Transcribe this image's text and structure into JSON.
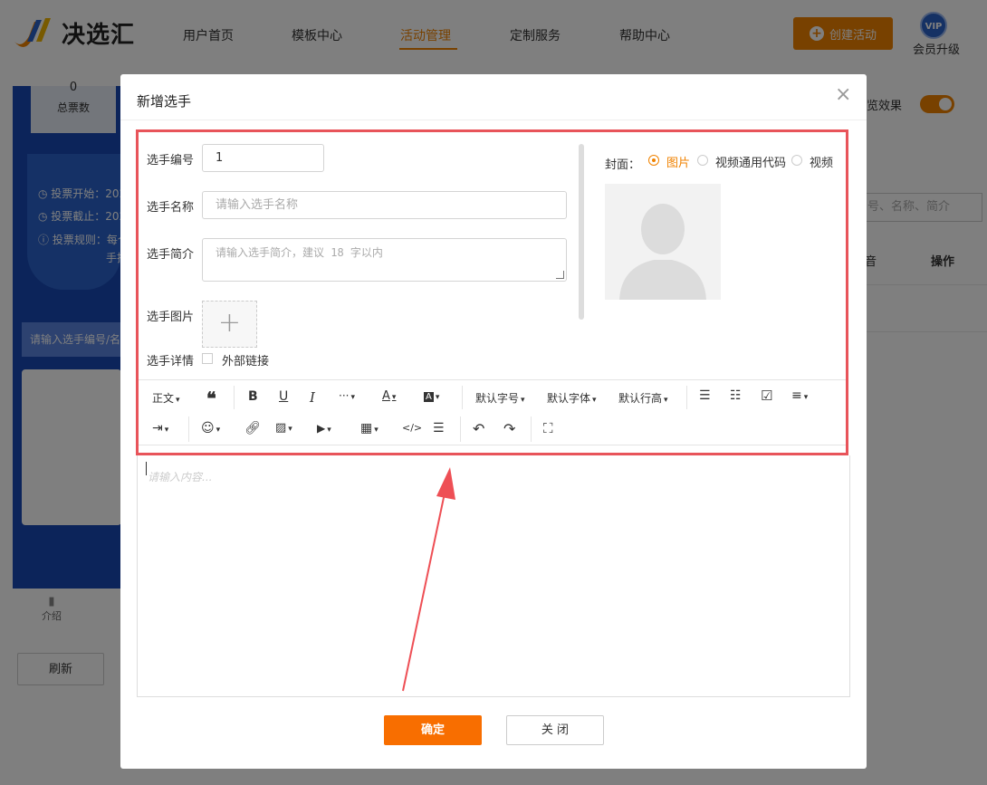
{
  "header": {
    "logo_text": "决选汇",
    "nav": [
      "用户首页",
      "模板中心",
      "活动管理",
      "定制服务",
      "帮助中心"
    ],
    "active_nav": "活动管理",
    "create_button": "创建活动",
    "vip_badge": "VIP",
    "vip_label": "会员升级"
  },
  "background": {
    "stat_number": "0",
    "stat_label": "总票数",
    "info_start": "投票开始：202",
    "info_end": "投票截止：202",
    "info_rules": "投票规则：每个",
    "info_rules_cont": "手把",
    "search_placeholder": "请输入选手编号/名称",
    "intro_tab": "介绍",
    "refresh_button": "刷新",
    "preview_label": "览效果",
    "search_hint": "号、名称、简介",
    "column_mark": "音",
    "column_operation": "操作"
  },
  "modal": {
    "title": "新增选手",
    "close_icon": "×",
    "fields": {
      "number_label": "选手编号",
      "number_value": "1",
      "name_label": "选手名称",
      "name_placeholder": "请输入选手名称",
      "intro_label": "选手简介",
      "intro_placeholder": "请输入选手简介，建议 18 字以内",
      "image_label": "选手图片",
      "detail_label": "选手详情",
      "external_link_label": "外部链接"
    },
    "cover": {
      "label": "封面：",
      "options": [
        "图片",
        "视频通用代码",
        "视频"
      ],
      "selected": "图片"
    },
    "toolbar": {
      "paragraph": "正文",
      "font_size": "默认字号",
      "font_family": "默认字体",
      "line_height": "默认行高"
    },
    "editor_placeholder": "请输入内容...",
    "confirm_button": "确定",
    "close_button": "关 闭"
  },
  "colors": {
    "accent": "#f08200",
    "highlight_box": "#e8545a",
    "left_panel": "#1848b4"
  }
}
